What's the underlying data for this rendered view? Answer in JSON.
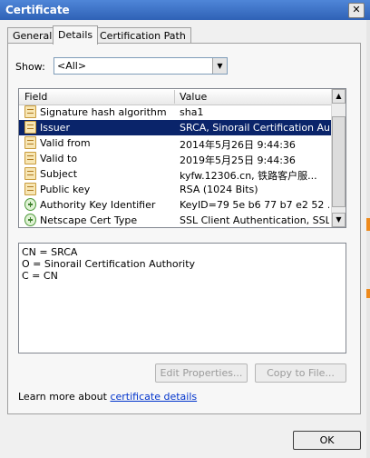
{
  "window": {
    "title": "Certificate",
    "close_glyph": "✕"
  },
  "tabs": [
    {
      "label": "General"
    },
    {
      "label": "Details",
      "active": true
    },
    {
      "label": "Certification Path"
    }
  ],
  "show": {
    "label": "Show:",
    "value": "<All>"
  },
  "list": {
    "headers": {
      "field": "Field",
      "value": "Value"
    },
    "rows": [
      {
        "field": "Signature hash algorithm",
        "value": "sha1",
        "icon": "certificate-field-icon"
      },
      {
        "field": "Issuer",
        "value": "SRCA, Sinorail Certification Au...",
        "icon": "certificate-field-icon",
        "selected": true
      },
      {
        "field": "Valid from",
        "value": "2014年5月26日 9:44:36",
        "icon": "certificate-field-icon"
      },
      {
        "field": "Valid to",
        "value": "2019年5月25日 9:44:36",
        "icon": "certificate-field-icon"
      },
      {
        "field": "Subject",
        "value": "kyfw.12306.cn, 铁路客户服...",
        "icon": "certificate-field-icon"
      },
      {
        "field": "Public key",
        "value": "RSA (1024 Bits)",
        "icon": "certificate-field-icon"
      },
      {
        "field": "Authority Key Identifier",
        "value": "KeyID=79 5e b6 77 b7 e2 52 ...",
        "icon": "extension-icon"
      },
      {
        "field": "Netscape Cert Type",
        "value": "SSL Client Authentication, SSL ...",
        "icon": "extension-icon"
      }
    ]
  },
  "detail_lines": [
    "CN = SRCA",
    "O = Sinorail Certification Authority",
    "C = CN"
  ],
  "buttons": {
    "edit_properties": "Edit Properties...",
    "copy_to_file": "Copy to File...",
    "ok": "OK"
  },
  "learn_more": {
    "prefix": "Learn more about ",
    "link": "certificate details"
  },
  "colors": {
    "selection": "#0a246a",
    "titlebar": "#2f62b6",
    "link": "#0033cc"
  }
}
